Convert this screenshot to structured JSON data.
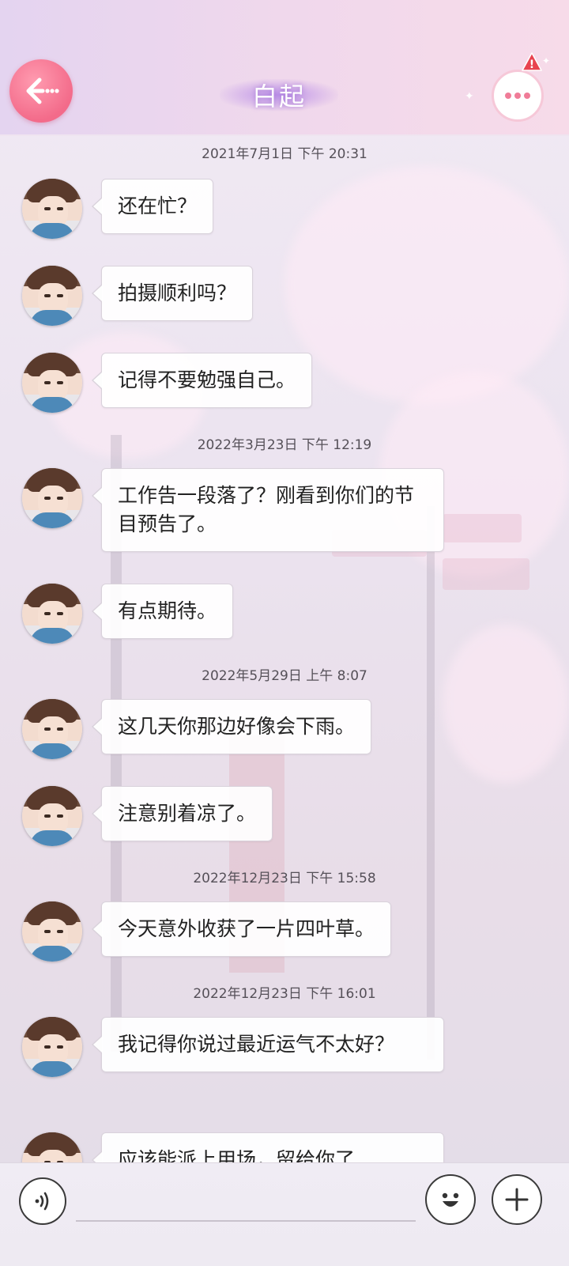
{
  "header": {
    "title": "白起",
    "back_icon": "arrow-left-icon",
    "more_icon": "more-dots-icon",
    "alert_badge": "!"
  },
  "messages": [
    {
      "type": "timestamp",
      "text": "2021年7月1日  下午 20:31"
    },
    {
      "type": "msg",
      "text": "还在忙？"
    },
    {
      "type": "msg",
      "text": "拍摄顺利吗？"
    },
    {
      "type": "msg",
      "text": "记得不要勉强自己。"
    },
    {
      "type": "timestamp",
      "text": "2022年3月23日  下午 12:19"
    },
    {
      "type": "msg",
      "text": "工作告一段落了？刚看到你们的节目预告了。"
    },
    {
      "type": "msg",
      "text": "有点期待。"
    },
    {
      "type": "timestamp",
      "text": "2022年5月29日  上午 8:07"
    },
    {
      "type": "msg",
      "text": "这几天你那边好像会下雨。"
    },
    {
      "type": "msg",
      "text": "注意别着凉了。"
    },
    {
      "type": "timestamp",
      "text": "2022年12月23日  下午 15:58"
    },
    {
      "type": "msg",
      "text": "今天意外收获了一片四叶草。"
    },
    {
      "type": "timestamp",
      "text": "2022年12月23日  下午 16:01"
    },
    {
      "type": "msg",
      "text": "我记得你说过最近运气不太好？"
    },
    {
      "type": "msg",
      "text": "应该能派上用场，留给你了"
    }
  ],
  "input_bar": {
    "voice_icon": "voice-icon",
    "emoji_icon": "emoji-icon",
    "plus_icon": "plus-icon"
  },
  "colors": {
    "back_button": "#f36b8a",
    "header_gradient_start": "#e4d4f0",
    "header_gradient_end": "#f7dbe9",
    "bubble": "#ffffff",
    "alert_badge": "#e8434f"
  }
}
